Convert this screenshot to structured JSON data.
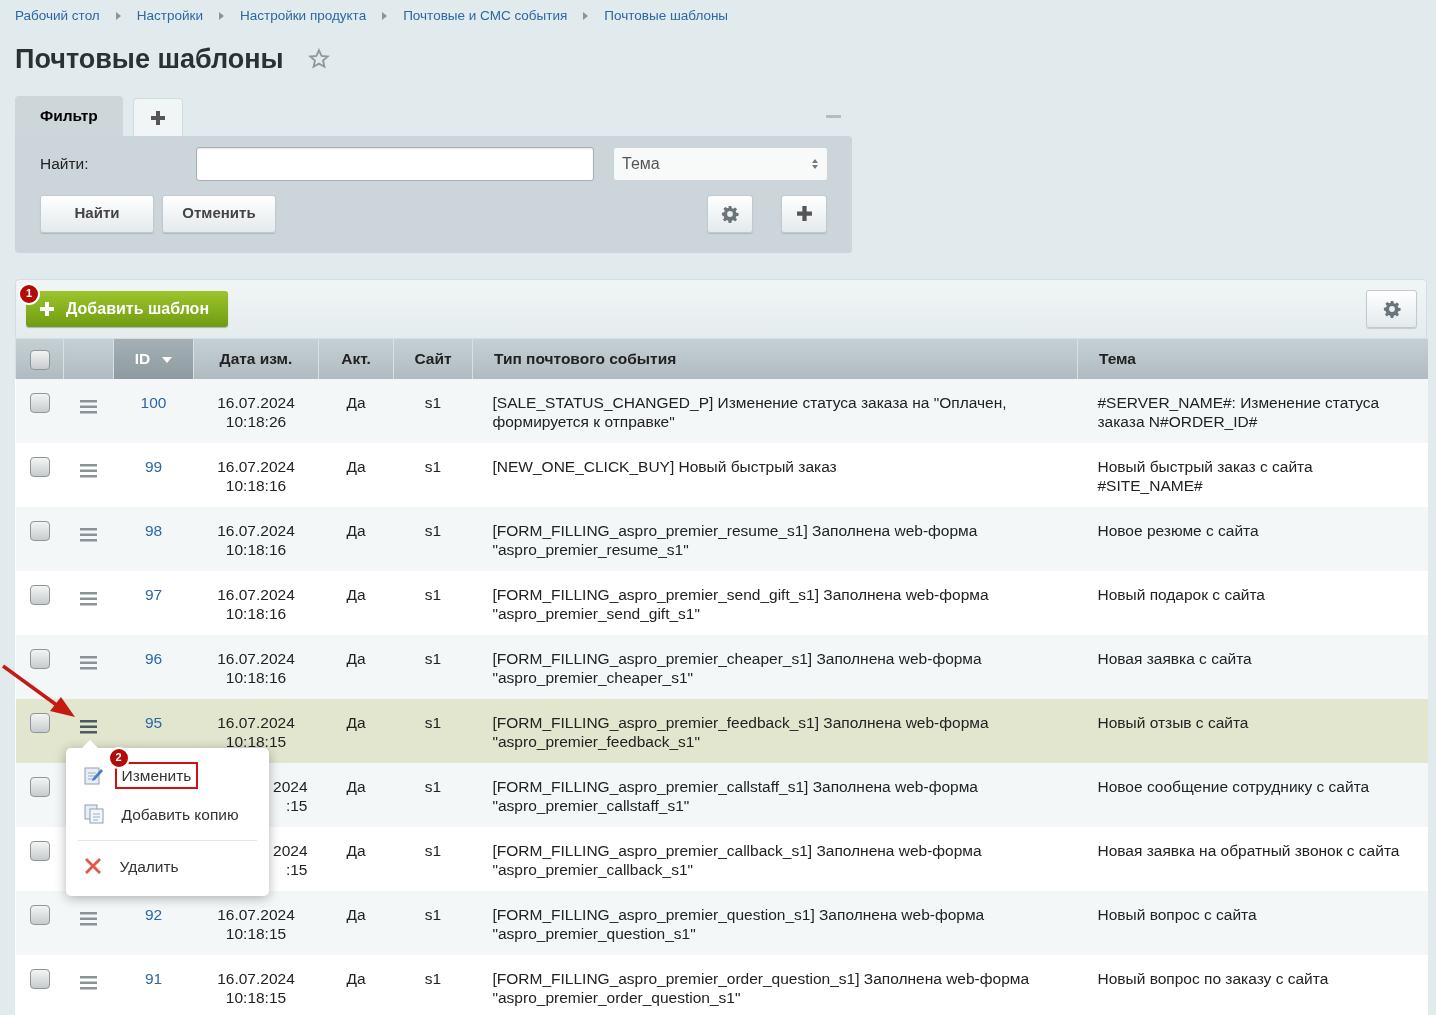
{
  "breadcrumbs": [
    "Рабочий стол",
    "Настройки",
    "Настройки продукта",
    "Почтовые и СМС события",
    "Почтовые шаблоны"
  ],
  "title": "Почтовые шаблоны",
  "favorite": false,
  "filter": {
    "tabs": [
      {
        "label": "Фильтр",
        "kind": "text",
        "selected": true
      },
      {
        "kind": "add",
        "selected": false
      }
    ],
    "find_label": "Найти:",
    "field_select": "Тема",
    "buttons": [
      "Найти",
      "Отменить"
    ]
  },
  "toolbar": {
    "add_button": "Добавить шаблон",
    "badge": "1"
  },
  "table": {
    "all_checked": false,
    "columns": [
      {
        "kind": "check",
        "sorted": false
      },
      {
        "kind": "menu",
        "sorted": false
      },
      {
        "label": "ID",
        "kind": "id",
        "sorted": true
      },
      {
        "label": "Дата изм.",
        "kind": "date",
        "sorted": false
      },
      {
        "label": "Акт.",
        "kind": "active",
        "sorted": false
      },
      {
        "label": "Сайт",
        "kind": "site",
        "sorted": false
      },
      {
        "label": "Тип почтового события",
        "kind": "type",
        "sorted": false
      },
      {
        "label": "Тема",
        "kind": "subject",
        "sorted": false
      }
    ],
    "rows": [
      {
        "checked": false,
        "selected": false,
        "id": "100",
        "date": "16.07.2024",
        "time": "10:18:26",
        "active": "Да",
        "site": "s1",
        "event_type": "[SALE_STATUS_CHANGED_P] Изменение статуса заказа на \"Оплачен, формируется к отправке\"",
        "subject": "#SERVER_NAME#: Изменение статуса заказа N#ORDER_ID#"
      },
      {
        "checked": false,
        "selected": false,
        "id": "99",
        "date": "16.07.2024",
        "time": "10:18:16",
        "active": "Да",
        "site": "s1",
        "event_type": "[NEW_ONE_CLICK_BUY] Новый быстрый заказ",
        "subject": "Новый быстрый заказ с сайта #SITE_NAME#"
      },
      {
        "checked": false,
        "selected": false,
        "id": "98",
        "date": "16.07.2024",
        "time": "10:18:16",
        "active": "Да",
        "site": "s1",
        "event_type": "[FORM_FILLING_aspro_premier_resume_s1] Заполнена web-форма \"aspro_premier_resume_s1\"",
        "subject": "Новое резюме с сайта"
      },
      {
        "checked": false,
        "selected": false,
        "id": "97",
        "date": "16.07.2024",
        "time": "10:18:16",
        "active": "Да",
        "site": "s1",
        "event_type": "[FORM_FILLING_aspro_premier_send_gift_s1] Заполнена web-форма \"aspro_premier_send_gift_s1\"",
        "subject": "Новый подарок с сайта"
      },
      {
        "checked": false,
        "selected": false,
        "id": "96",
        "date": "16.07.2024",
        "time": "10:18:16",
        "active": "Да",
        "site": "s1",
        "event_type": "[FORM_FILLING_aspro_premier_cheaper_s1] Заполнена web-форма \"aspro_premier_cheaper_s1\"",
        "subject": "Новая заявка с сайта"
      },
      {
        "checked": false,
        "selected": true,
        "id": "95",
        "date": "16.07.2024",
        "time": "10:18:15",
        "active": "Да",
        "site": "s1",
        "event_type": "[FORM_FILLING_aspro_premier_feedback_s1] Заполнена web-форма \"aspro_premier_feedback_s1\"",
        "subject": "Новый отзыв с сайта"
      },
      {
        "checked": false,
        "selected": false,
        "date": "2024",
        "time": ":15",
        "active": "Да",
        "site": "s1",
        "event_type": "[FORM_FILLING_aspro_premier_callstaff_s1] Заполнена web-форма \"aspro_premier_callstaff_s1\"",
        "subject": "Новое сообщение сотруднику с сайта"
      },
      {
        "checked": false,
        "selected": false,
        "date": "2024",
        "time": ":15",
        "active": "Да",
        "site": "s1",
        "event_type": "[FORM_FILLING_aspro_premier_callback_s1] Заполнена web-форма \"aspro_premier_callback_s1\"",
        "subject": "Новая заявка на обратный звонок с сайта"
      },
      {
        "checked": false,
        "selected": false,
        "id": "92",
        "date": "16.07.2024",
        "time": "10:18:15",
        "active": "Да",
        "site": "s1",
        "event_type": "[FORM_FILLING_aspro_premier_question_s1] Заполнена web-форма \"aspro_premier_question_s1\"",
        "subject": "Новый вопрос с сайта"
      },
      {
        "checked": false,
        "selected": false,
        "id": "91",
        "date": "16.07.2024",
        "time": "10:18:15",
        "active": "Да",
        "site": "s1",
        "event_type": "[FORM_FILLING_aspro_premier_order_question_s1] Заполнена web-форма \"aspro_premier_order_question_s1\"",
        "subject": "Новый вопрос по заказу с сайта"
      }
    ]
  },
  "context_menu": {
    "items": [
      {
        "label": "Изменить",
        "kind": "edit",
        "outlined": true,
        "badge": "2",
        "divider_before": false
      },
      {
        "label": "Добавить копию",
        "kind": "copy",
        "outlined": false,
        "divider_before": false
      },
      {
        "label": "Удалить",
        "kind": "delete",
        "outlined": false,
        "divider_before": true
      }
    ]
  }
}
